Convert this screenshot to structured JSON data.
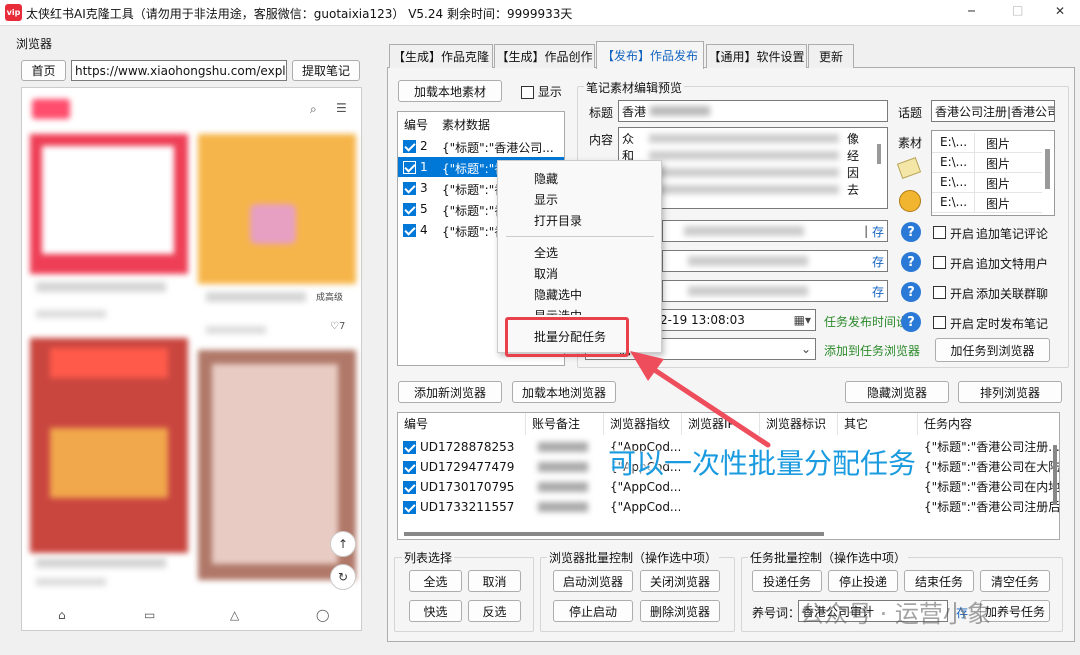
{
  "app": {
    "title": "太侠红书AI克隆工具（请勿用于非法用途，客服微信：guotaixia123）  V5.24  剩余时间：9999933天",
    "logo": "vip",
    "min": "─",
    "max": "□",
    "close": "✕"
  },
  "browser": {
    "group_label": "浏览器",
    "home": "首页",
    "url": "https://www.xiaohongshu.com/explore",
    "extract": "提取笔记",
    "card_caption": "成高级",
    "like_count": "7"
  },
  "tabs": [
    "【生成】作品克隆",
    "【生成】作品创作",
    "【发布】作品发布",
    "【通用】软件设置",
    "更新"
  ],
  "active_tab": 2,
  "material": {
    "load_btn": "加载本地素材",
    "show_label": "显示",
    "col_no": "编号",
    "col_data": "素材数据",
    "rows": [
      {
        "no": "2",
        "data": "{\"标题\":\"香港公司..."
      },
      {
        "no": "1",
        "data": "{\"标题\":\"香港公司..."
      },
      {
        "no": "3",
        "data": "{\"标题\":\"香"
      },
      {
        "no": "5",
        "data": "{\"标题\":\"香"
      },
      {
        "no": "4",
        "data": "{\"标题\":\"香"
      }
    ]
  },
  "context_menu": {
    "items": [
      "隐藏",
      "显示",
      "打开目录",
      "全选",
      "取消",
      "隐藏选中",
      "显示选中",
      "批量分配任务"
    ]
  },
  "editor": {
    "group_label": "笔记素材编辑预览",
    "title_label": "标题",
    "title_value": "香港",
    "content_label": "内容",
    "content_value": "众",
    "content_value2": "和",
    "content_right": [
      "像",
      "经",
      "因",
      "去"
    ],
    "topic_label": "话题",
    "topic_value": "香港公司注册|香港公司",
    "material_label": "素材",
    "files": [
      {
        "path": "E:\\...",
        "type": "图片"
      },
      {
        "path": "E:\\...",
        "type": "图片"
      },
      {
        "path": "E:\\...",
        "type": "图片"
      },
      {
        "path": "E:\\...",
        "type": "图片"
      }
    ],
    "save": "存",
    "datetime": "2-19 13:08:03",
    "task_time_link": "任务发布时间设置",
    "add_to_task_link": "添加到任务浏览器",
    "add_task_btn": "加任务到浏览器",
    "options": [
      {
        "label": "开启",
        "text": "追加笔记评论"
      },
      {
        "label": "开启",
        "text": "追加文特用户"
      },
      {
        "label": "开启",
        "text": "添加关联群聊"
      },
      {
        "label": "开启",
        "text": "定时发布笔记"
      }
    ],
    "help": "?",
    "select_prefix": "浏"
  },
  "browser_tools": {
    "add_new": "添加新浏览器",
    "load_local": "加载本地浏览器",
    "hide": "隐藏浏览器",
    "arrange": "排列浏览器"
  },
  "table": {
    "cols": [
      "编号",
      "账号备注",
      "浏览器指纹",
      "浏览器IP",
      "浏览器标识",
      "其它",
      "任务内容"
    ],
    "rows": [
      {
        "id": "UD1728878253",
        "fp": "{\"AppCod...",
        "task": "{\"标题\":\"香港公司注册..."
      },
      {
        "id": "UD1729477479",
        "fp": "{\"AppCod...",
        "task": "{\"标题\":\"香港公司在大陆..."
      },
      {
        "id": "UD1730170795",
        "fp": "{\"AppCod...",
        "task": "{\"标题\":\"香港公司在内地..."
      },
      {
        "id": "UD1733211557",
        "fp": "{\"AppCod...",
        "task": "{\"标题\":\"香港公司注册后..."
      }
    ]
  },
  "annotation": "可以一次性批量分配任务",
  "bottom": {
    "list_select": {
      "label": "列表选择",
      "all": "全选",
      "cancel": "取消",
      "quick": "快选",
      "invert": "反选"
    },
    "browser_ctrl": {
      "label": "浏览器批量控制（操作选中项）",
      "start": "启动浏览器",
      "close": "关闭浏览器",
      "stop": "停止启动",
      "delete": "删除浏览器"
    },
    "task_ctrl": {
      "label": "任务批量控制（操作选中项）",
      "post": "投递任务",
      "stop_post": "停止投递",
      "end": "结束任务",
      "clear": "清空任务",
      "keyword_label": "养号词：",
      "keyword_value": "香港公司审计",
      "save": "存",
      "add_btn": "加养号任务"
    }
  },
  "watermark": "公众号 · 运营小象",
  "colors": {
    "accent": "#2b79d6",
    "annotation": "#1a9be0",
    "highlight_border": "#e8414c",
    "link": "#2a8a2a"
  }
}
